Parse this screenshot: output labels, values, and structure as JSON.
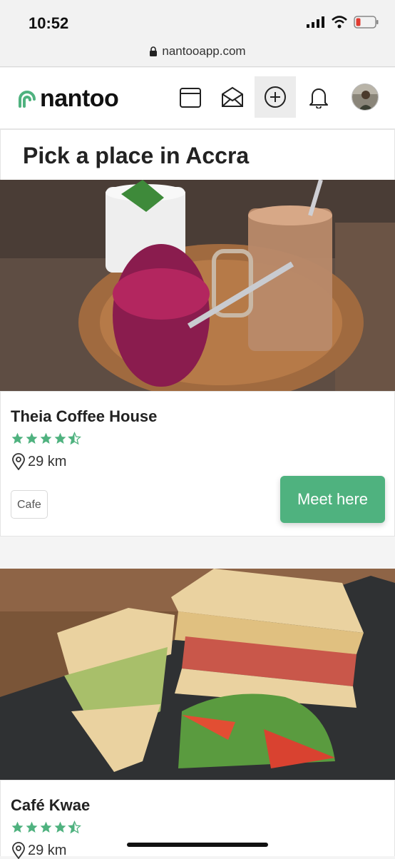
{
  "status_bar": {
    "time": "10:52"
  },
  "browser": {
    "url": "nantooapp.com"
  },
  "app": {
    "logo_text": "nantoo",
    "brand_color": "#4fb27f",
    "nav_icons": [
      "calendar-icon",
      "envelope-icon",
      "plus-circle-icon",
      "bell-icon",
      "avatar"
    ]
  },
  "page": {
    "title": "Pick a place in Accra"
  },
  "places": [
    {
      "name": "Theia Coffee House",
      "rating": 4.5,
      "distance": "29 km",
      "tag": "Cafe",
      "action_label": "Meet here"
    },
    {
      "name": "Café Kwae",
      "rating": 4.5,
      "distance": "29 km"
    }
  ]
}
